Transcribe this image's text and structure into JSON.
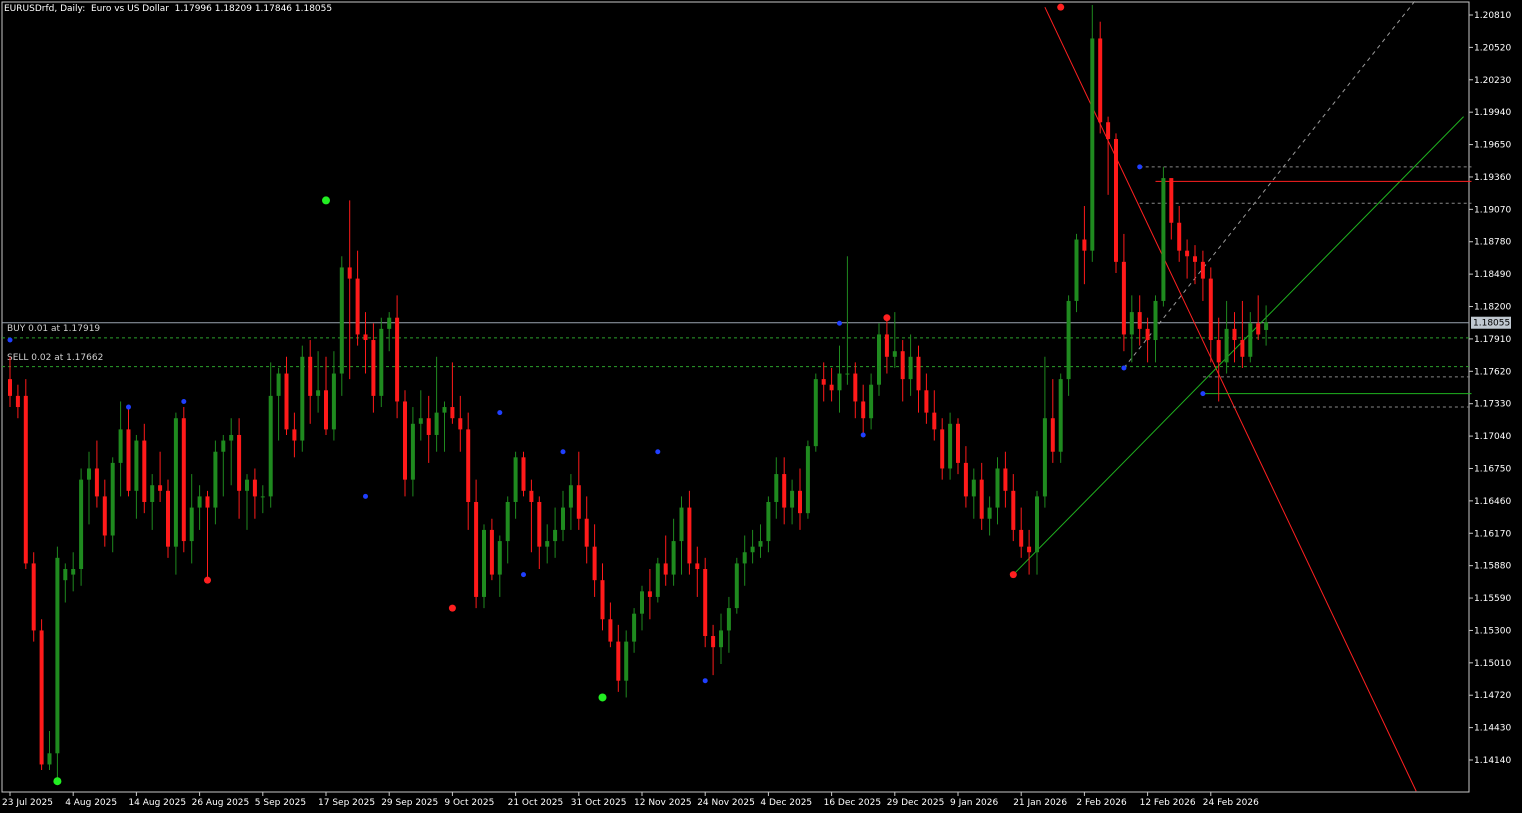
{
  "header": {
    "symbol": "EURUSDrfd",
    "timeframe": "Daily",
    "description": "Euro vs US Dollar",
    "ohlc": "1.17996 1.18209 1.17846 1.18055"
  },
  "orders": [
    {
      "label": "BUY 0.01 at 1.17919",
      "price": 1.17919,
      "color": "#2ca02c"
    },
    {
      "label": "SELL 0.02 at 1.17662",
      "price": 1.17662,
      "color": "#2ca02c"
    }
  ],
  "colors": {
    "background": "#000000",
    "bull": "#1f8a1f",
    "bear": "#ff1a1a",
    "grid": "#9a9a9a",
    "text": "#ffffff",
    "bid_line": "#9aa4b0",
    "pivot_blue": "#1f3fff",
    "pivot_green": "#22ee22",
    "pivot_red": "#ff2020"
  },
  "chart_data": {
    "type": "candlestick",
    "symbol": "EURUSDrfd",
    "timeframe": "Daily",
    "ylim": [
      1.1386,
      1.2095
    ],
    "yticks": [
      1.2081,
      1.2052,
      1.2023,
      1.1994,
      1.1965,
      1.1936,
      1.1907,
      1.1878,
      1.1849,
      1.182,
      1.1791,
      1.1762,
      1.1733,
      1.1704,
      1.1675,
      1.1646,
      1.1617,
      1.1588,
      1.1559,
      1.153,
      1.1501,
      1.1472,
      1.1443,
      1.1414
    ],
    "ytick_labels": [
      "1.20810",
      "1.20520",
      "1.20230",
      "1.19940",
      "1.19650",
      "1.19360",
      "1.19070",
      "1.18780",
      "1.18490",
      "1.18200",
      "1.17910",
      "1.17620",
      "1.17330",
      "1.17040",
      "1.16750",
      "1.16460",
      "1.16170",
      "1.15880",
      "1.15590",
      "1.15300",
      "1.15010",
      "1.14720",
      "1.14430",
      "1.14140"
    ],
    "xticks": [
      {
        "label": "23 Jul 2025",
        "index": 0
      },
      {
        "label": "4 Aug 2025",
        "index": 8
      },
      {
        "label": "14 Aug 2025",
        "index": 16
      },
      {
        "label": "26 Aug 2025",
        "index": 24
      },
      {
        "label": "5 Sep 2025",
        "index": 32
      },
      {
        "label": "17 Sep 2025",
        "index": 40
      },
      {
        "label": "29 Sep 2025",
        "index": 48
      },
      {
        "label": "9 Oct 2025",
        "index": 56
      },
      {
        "label": "21 Oct 2025",
        "index": 64
      },
      {
        "label": "31 Oct 2025",
        "index": 72
      },
      {
        "label": "12 Nov 2025",
        "index": 80
      },
      {
        "label": "24 Nov 2025",
        "index": 88
      },
      {
        "label": "4 Dec 2025",
        "index": 96
      },
      {
        "label": "16 Dec 2025",
        "index": 104
      },
      {
        "label": "29 Dec 2025",
        "index": 112
      },
      {
        "label": "9 Jan 2026",
        "index": 120
      },
      {
        "label": "21 Jan 2026",
        "index": 128
      },
      {
        "label": "2 Feb 2026",
        "index": 136
      },
      {
        "label": "12 Feb 2026",
        "index": 144
      },
      {
        "label": "24 Feb 2026",
        "index": 152
      }
    ],
    "last_price": 1.18055,
    "last_price_label": "1.18055",
    "candles": [
      [
        1.1755,
        1.1775,
        1.173,
        1.174
      ],
      [
        1.174,
        1.175,
        1.172,
        1.173
      ],
      [
        1.174,
        1.1755,
        1.1585,
        1.159
      ],
      [
        1.159,
        1.16,
        1.152,
        1.153
      ],
      [
        1.153,
        1.154,
        1.1405,
        1.141
      ],
      [
        1.141,
        1.144,
        1.1405,
        1.142
      ],
      [
        1.142,
        1.1605,
        1.1395,
        1.1595
      ],
      [
        1.1575,
        1.159,
        1.1555,
        1.1585
      ],
      [
        1.158,
        1.16,
        1.1565,
        1.1585
      ],
      [
        1.1585,
        1.1675,
        1.157,
        1.1665
      ],
      [
        1.1665,
        1.169,
        1.1625,
        1.1675
      ],
      [
        1.1675,
        1.17,
        1.164,
        1.165
      ],
      [
        1.165,
        1.1665,
        1.1605,
        1.1615
      ],
      [
        1.1615,
        1.1685,
        1.16,
        1.168
      ],
      [
        1.168,
        1.1735,
        1.165,
        1.171
      ],
      [
        1.171,
        1.173,
        1.165,
        1.1655
      ],
      [
        1.1655,
        1.1705,
        1.163,
        1.17
      ],
      [
        1.17,
        1.1715,
        1.1635,
        1.1645
      ],
      [
        1.1645,
        1.167,
        1.162,
        1.166
      ],
      [
        1.166,
        1.169,
        1.1645,
        1.1655
      ],
      [
        1.1655,
        1.1665,
        1.1595,
        1.1605
      ],
      [
        1.1605,
        1.1725,
        1.158,
        1.172
      ],
      [
        1.172,
        1.173,
        1.16,
        1.161
      ],
      [
        1.161,
        1.167,
        1.159,
        1.164
      ],
      [
        1.164,
        1.166,
        1.162,
        1.165
      ],
      [
        1.165,
        1.1655,
        1.1575,
        1.164
      ],
      [
        1.164,
        1.17,
        1.1625,
        1.169
      ],
      [
        1.169,
        1.1705,
        1.165,
        1.17
      ],
      [
        1.17,
        1.172,
        1.166,
        1.1705
      ],
      [
        1.1705,
        1.172,
        1.163,
        1.1655
      ],
      [
        1.1655,
        1.167,
        1.162,
        1.1665
      ],
      [
        1.1665,
        1.1675,
        1.163,
        1.165
      ],
      [
        1.165,
        1.166,
        1.1635,
        1.165
      ],
      [
        1.165,
        1.177,
        1.164,
        1.174
      ],
      [
        1.174,
        1.1765,
        1.17,
        1.176
      ],
      [
        1.176,
        1.1775,
        1.1705,
        1.171
      ],
      [
        1.171,
        1.1725,
        1.1685,
        1.17
      ],
      [
        1.17,
        1.1785,
        1.169,
        1.1775
      ],
      [
        1.1775,
        1.179,
        1.1715,
        1.174
      ],
      [
        1.174,
        1.178,
        1.1725,
        1.1745
      ],
      [
        1.1745,
        1.1775,
        1.1705,
        1.171
      ],
      [
        1.171,
        1.178,
        1.17,
        1.176
      ],
      [
        1.176,
        1.1865,
        1.174,
        1.1855
      ],
      [
        1.1855,
        1.1915,
        1.1755,
        1.1845
      ],
      [
        1.1845,
        1.187,
        1.1785,
        1.1795
      ],
      [
        1.1795,
        1.1815,
        1.176,
        1.179
      ],
      [
        1.179,
        1.1805,
        1.1725,
        1.174
      ],
      [
        1.174,
        1.181,
        1.173,
        1.18
      ],
      [
        1.18,
        1.1815,
        1.178,
        1.181
      ],
      [
        1.181,
        1.183,
        1.172,
        1.1735
      ],
      [
        1.1735,
        1.1745,
        1.165,
        1.1665
      ],
      [
        1.1665,
        1.173,
        1.165,
        1.1715
      ],
      [
        1.1715,
        1.1745,
        1.17,
        1.172
      ],
      [
        1.172,
        1.174,
        1.168,
        1.1705
      ],
      [
        1.1705,
        1.1775,
        1.169,
        1.1725
      ],
      [
        1.1725,
        1.1735,
        1.169,
        1.173
      ],
      [
        1.173,
        1.177,
        1.1715,
        1.172
      ],
      [
        1.172,
        1.174,
        1.169,
        1.171
      ],
      [
        1.171,
        1.1725,
        1.162,
        1.1645
      ],
      [
        1.1645,
        1.1665,
        1.155,
        1.156
      ],
      [
        1.156,
        1.1625,
        1.155,
        1.162
      ],
      [
        1.162,
        1.163,
        1.1575,
        1.158
      ],
      [
        1.158,
        1.1615,
        1.156,
        1.161
      ],
      [
        1.161,
        1.165,
        1.159,
        1.1645
      ],
      [
        1.1645,
        1.169,
        1.163,
        1.1685
      ],
      [
        1.1685,
        1.169,
        1.165,
        1.1655
      ],
      [
        1.1655,
        1.1665,
        1.16,
        1.1645
      ],
      [
        1.1645,
        1.165,
        1.1585,
        1.1605
      ],
      [
        1.1605,
        1.1625,
        1.159,
        1.161
      ],
      [
        1.161,
        1.164,
        1.1595,
        1.162
      ],
      [
        1.162,
        1.1655,
        1.161,
        1.164
      ],
      [
        1.164,
        1.167,
        1.162,
        1.166
      ],
      [
        1.166,
        1.169,
        1.162,
        1.163
      ],
      [
        1.163,
        1.165,
        1.159,
        1.1605
      ],
      [
        1.1605,
        1.1625,
        1.156,
        1.1575
      ],
      [
        1.1575,
        1.159,
        1.153,
        1.154
      ],
      [
        1.154,
        1.1555,
        1.1515,
        1.152
      ],
      [
        1.152,
        1.1535,
        1.1475,
        1.1485
      ],
      [
        1.1485,
        1.153,
        1.147,
        1.152
      ],
      [
        1.152,
        1.155,
        1.151,
        1.1545
      ],
      [
        1.1545,
        1.157,
        1.153,
        1.1565
      ],
      [
        1.1565,
        1.1585,
        1.154,
        1.156
      ],
      [
        1.156,
        1.1595,
        1.1555,
        1.159
      ],
      [
        1.159,
        1.1615,
        1.157,
        1.158
      ],
      [
        1.158,
        1.163,
        1.157,
        1.161
      ],
      [
        1.161,
        1.165,
        1.158,
        1.164
      ],
      [
        1.164,
        1.1655,
        1.158,
        1.159
      ],
      [
        1.159,
        1.1605,
        1.156,
        1.1585
      ],
      [
        1.1585,
        1.1595,
        1.1515,
        1.1525
      ],
      [
        1.1525,
        1.1535,
        1.149,
        1.1515
      ],
      [
        1.1515,
        1.1545,
        1.15,
        1.153
      ],
      [
        1.153,
        1.156,
        1.151,
        1.155
      ],
      [
        1.155,
        1.1595,
        1.1545,
        1.159
      ],
      [
        1.159,
        1.1615,
        1.157,
        1.16
      ],
      [
        1.16,
        1.162,
        1.159,
        1.1605
      ],
      [
        1.1605,
        1.1625,
        1.1595,
        1.161
      ],
      [
        1.161,
        1.165,
        1.16,
        1.1645
      ],
      [
        1.1645,
        1.1685,
        1.163,
        1.167
      ],
      [
        1.167,
        1.1685,
        1.1625,
        1.164
      ],
      [
        1.164,
        1.1665,
        1.1625,
        1.1655
      ],
      [
        1.1655,
        1.1675,
        1.162,
        1.1635
      ],
      [
        1.1635,
        1.17,
        1.163,
        1.1695
      ],
      [
        1.1695,
        1.176,
        1.169,
        1.1755
      ],
      [
        1.1755,
        1.177,
        1.1735,
        1.175
      ],
      [
        1.175,
        1.1765,
        1.1735,
        1.1745
      ],
      [
        1.1745,
        1.1785,
        1.1725,
        1.176
      ],
      [
        1.176,
        1.1865,
        1.175,
        1.176
      ],
      [
        1.176,
        1.177,
        1.172,
        1.1735
      ],
      [
        1.1735,
        1.175,
        1.1705,
        1.172
      ],
      [
        1.172,
        1.176,
        1.171,
        1.175
      ],
      [
        1.175,
        1.1805,
        1.174,
        1.1795
      ],
      [
        1.1795,
        1.181,
        1.176,
        1.1775
      ],
      [
        1.1775,
        1.1815,
        1.1765,
        1.178
      ],
      [
        1.178,
        1.179,
        1.1735,
        1.1755
      ],
      [
        1.1755,
        1.1795,
        1.174,
        1.1775
      ],
      [
        1.1775,
        1.1785,
        1.1725,
        1.1745
      ],
      [
        1.1745,
        1.176,
        1.1715,
        1.1725
      ],
      [
        1.1725,
        1.1745,
        1.17,
        1.171
      ],
      [
        1.171,
        1.172,
        1.1665,
        1.1675
      ],
      [
        1.1675,
        1.1725,
        1.1665,
        1.1715
      ],
      [
        1.1715,
        1.172,
        1.167,
        1.168
      ],
      [
        1.168,
        1.1695,
        1.164,
        1.165
      ],
      [
        1.165,
        1.1675,
        1.163,
        1.1665
      ],
      [
        1.1665,
        1.168,
        1.162,
        1.163
      ],
      [
        1.163,
        1.165,
        1.1615,
        1.164
      ],
      [
        1.164,
        1.1685,
        1.1625,
        1.1675
      ],
      [
        1.1675,
        1.169,
        1.164,
        1.1655
      ],
      [
        1.1655,
        1.167,
        1.161,
        1.162
      ],
      [
        1.162,
        1.164,
        1.1595,
        1.1605
      ],
      [
        1.1605,
        1.162,
        1.158,
        1.16
      ],
      [
        1.16,
        1.1655,
        1.158,
        1.165
      ],
      [
        1.165,
        1.1775,
        1.164,
        1.172
      ],
      [
        1.172,
        1.1755,
        1.168,
        1.169
      ],
      [
        1.169,
        1.176,
        1.168,
        1.1755
      ],
      [
        1.1755,
        1.183,
        1.174,
        1.1825
      ],
      [
        1.1825,
        1.1885,
        1.1815,
        1.188
      ],
      [
        1.188,
        1.191,
        1.184,
        1.187
      ],
      [
        1.187,
        1.209,
        1.186,
        1.206
      ],
      [
        1.206,
        1.2075,
        1.1975,
        1.1985
      ],
      [
        1.1985,
        1.199,
        1.192,
        1.197
      ],
      [
        1.197,
        1.1975,
        1.185,
        1.186
      ],
      [
        1.186,
        1.1885,
        1.178,
        1.1795
      ],
      [
        1.1795,
        1.183,
        1.177,
        1.1815
      ],
      [
        1.1815,
        1.183,
        1.1785,
        1.18
      ],
      [
        1.18,
        1.181,
        1.177,
        1.179
      ],
      [
        1.179,
        1.183,
        1.177,
        1.1825
      ],
      [
        1.1825,
        1.1945,
        1.182,
        1.1935
      ],
      [
        1.1935,
        1.193,
        1.188,
        1.1895
      ],
      [
        1.1895,
        1.191,
        1.186,
        1.187
      ],
      [
        1.187,
        1.188,
        1.1845,
        1.1865
      ],
      [
        1.1865,
        1.1875,
        1.184,
        1.186
      ],
      [
        1.186,
        1.187,
        1.1825,
        1.1845
      ],
      [
        1.1845,
        1.1855,
        1.177,
        1.179
      ],
      [
        1.179,
        1.181,
        1.1735,
        1.177
      ],
      [
        1.177,
        1.1825,
        1.176,
        1.18
      ],
      [
        1.18,
        1.1815,
        1.177,
        1.179
      ],
      [
        1.179,
        1.1825,
        1.1765,
        1.1775
      ],
      [
        1.1775,
        1.1815,
        1.177,
        1.1805
      ],
      [
        1.1805,
        1.183,
        1.179,
        1.1795
      ],
      [
        1.1799,
        1.1821,
        1.1785,
        1.1806
      ]
    ]
  }
}
